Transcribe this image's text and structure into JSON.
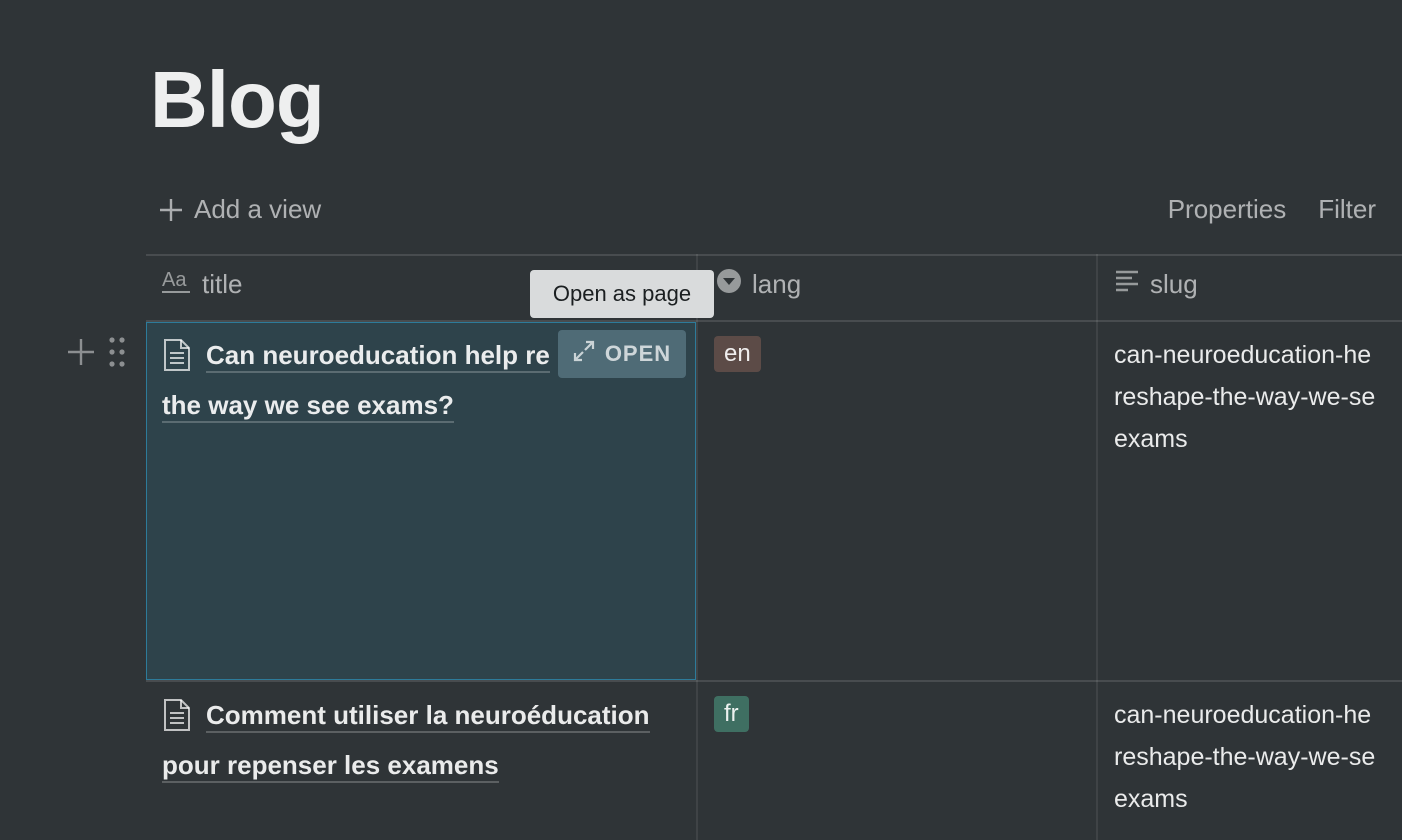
{
  "page": {
    "title": "Blog"
  },
  "toolbar": {
    "add_view_label": "Add a view",
    "properties_label": "Properties",
    "filter_label": "Filter"
  },
  "columns": [
    {
      "name": "title",
      "icon": "text-aa-icon"
    },
    {
      "name": "lang",
      "icon": "select-dropdown-icon"
    },
    {
      "name": "slug",
      "icon": "text-lines-icon"
    }
  ],
  "tooltip": "Open as page",
  "open_button_label": "OPEN",
  "rows": [
    {
      "title_line1": "Can neuroeducation help re",
      "title_line2": "the way we see exams?",
      "lang": "en",
      "slug": "can-neuroeducation-he\nreshape-the-way-we-se\nexams"
    },
    {
      "title_line1": "Comment utiliser la neuroéducation",
      "title_line2": "pour repenser les examens",
      "lang": "fr",
      "slug": "can-neuroeducation-he\nreshape-the-way-we-se\nexams"
    }
  ],
  "colors": {
    "background": "#2f3437",
    "tag_en": "#5c4b47",
    "tag_fr": "#3f6f62",
    "selection": "#2eaadc"
  }
}
